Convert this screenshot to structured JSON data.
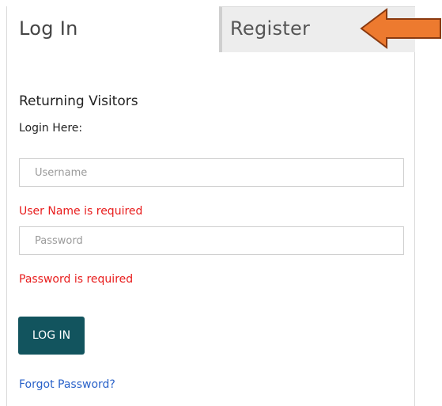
{
  "tabs": {
    "login_label": "Log In",
    "register_label": "Register"
  },
  "form": {
    "heading": "Returning Visitors",
    "subheading": "Login Here:",
    "username_placeholder": "Username",
    "password_placeholder": "Password",
    "username_error": "User Name is required",
    "password_error": "Password is required",
    "submit_label": "LOG IN",
    "forgot_label": "Forgot Password?"
  },
  "annotation": {
    "icon": "arrow-left-icon",
    "color": "#ed7a2f"
  },
  "colors": {
    "button": "#12545e",
    "error": "#e81c1c",
    "link": "#2a62c9"
  }
}
